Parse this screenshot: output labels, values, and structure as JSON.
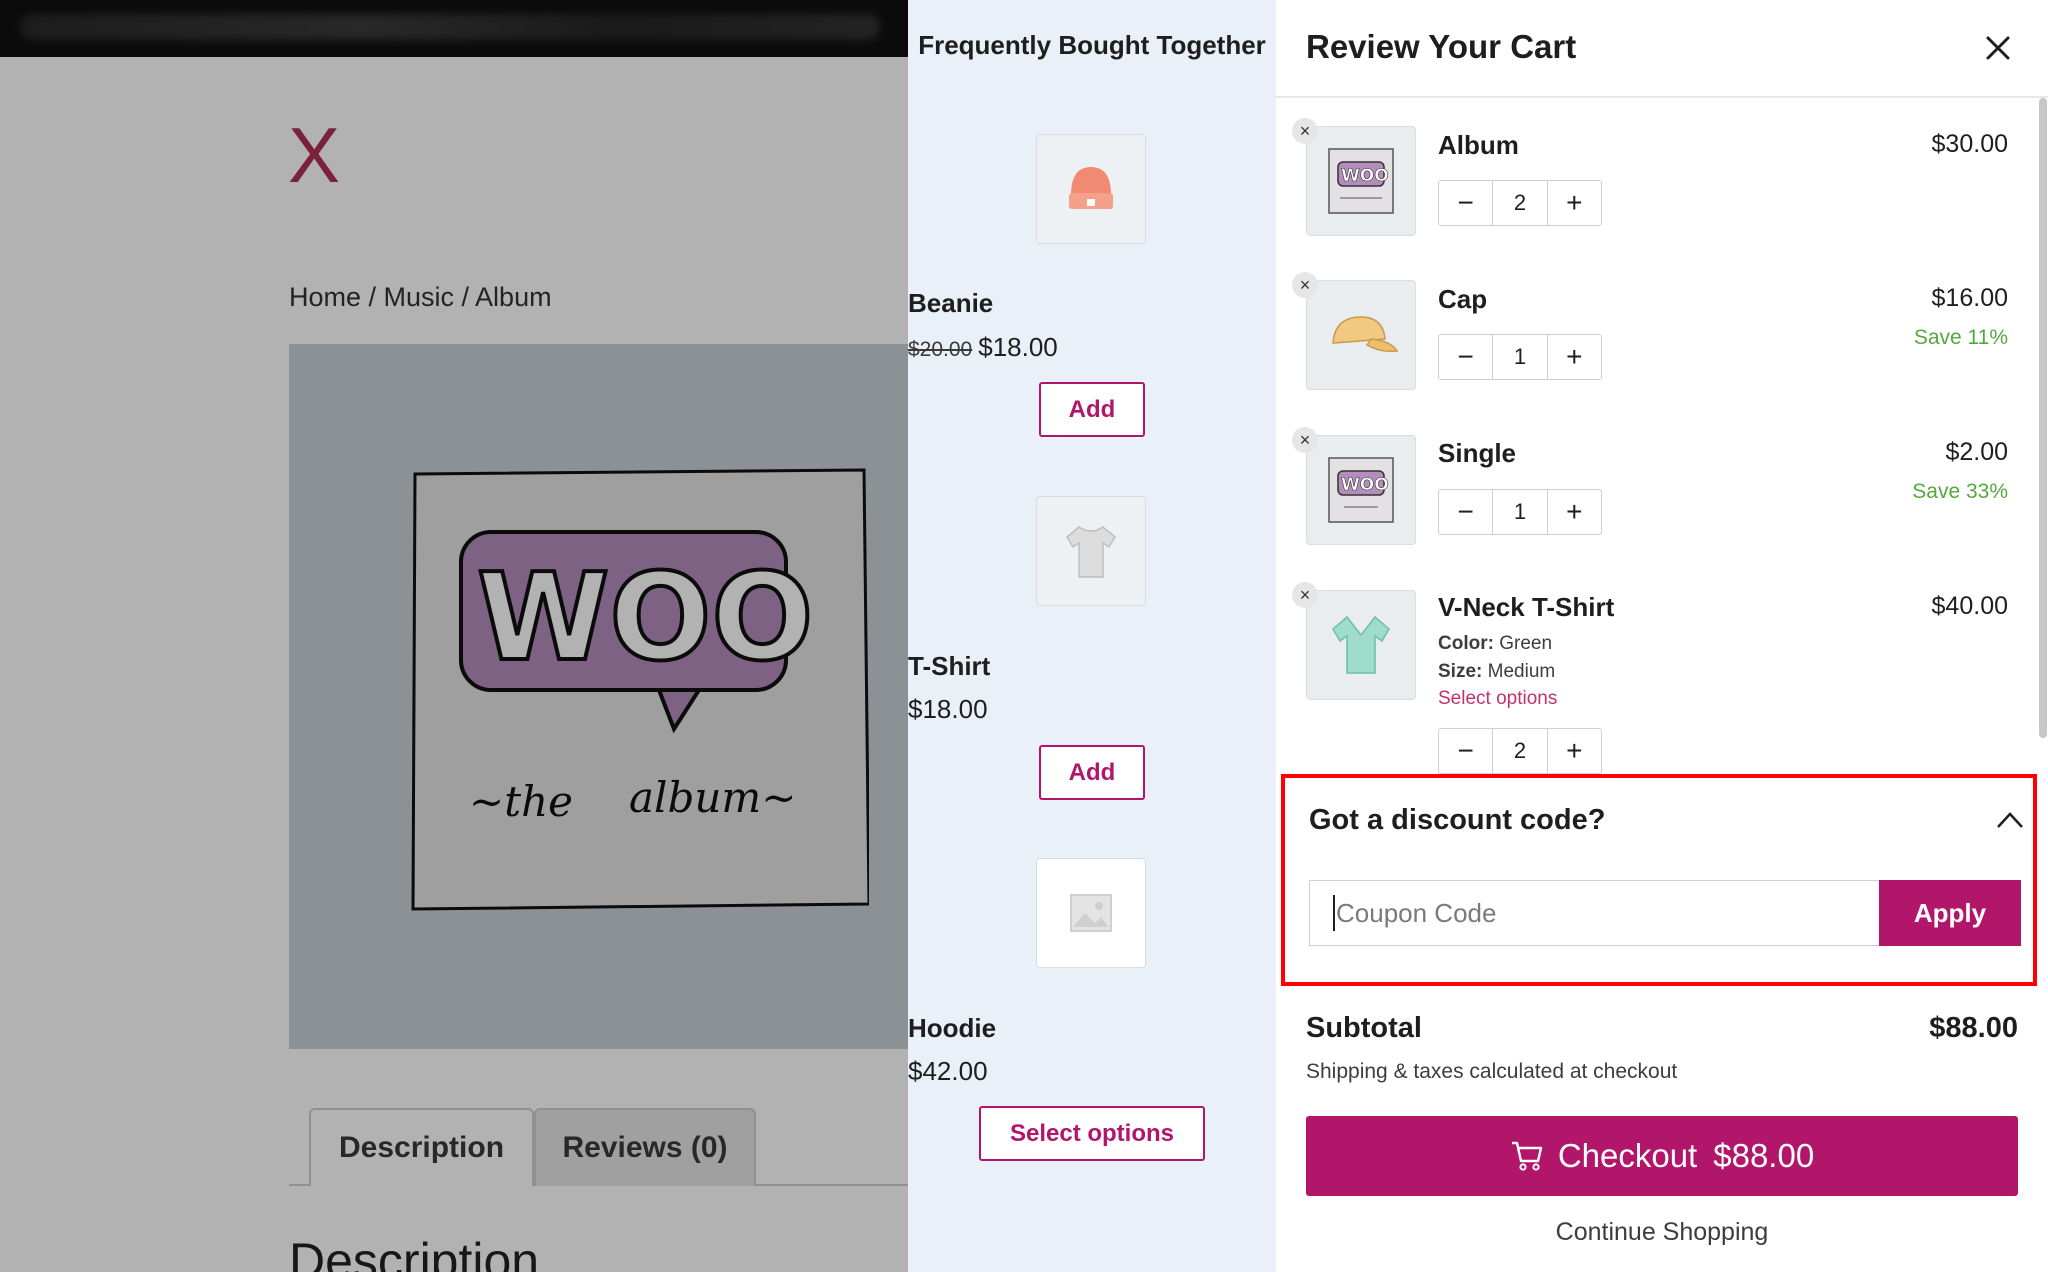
{
  "site": {
    "logo_text": "X",
    "breadcrumb": "Home / Music / Album",
    "tabs": [
      "Description",
      "Reviews (0)"
    ],
    "section_heading": "Description"
  },
  "fbt": {
    "title": "Frequently Bought Together",
    "items": [
      {
        "name": "Beanie",
        "old_price": "$20.00",
        "price": "$18.00",
        "button": "Add",
        "icon": "beanie-icon"
      },
      {
        "name": "T-Shirt",
        "price": "$18.00",
        "button": "Add",
        "icon": "tshirt-icon"
      },
      {
        "name": "Hoodie",
        "price": "$42.00",
        "button": "Select options",
        "icon": "image-placeholder-icon"
      }
    ]
  },
  "cart": {
    "title": "Review Your Cart",
    "items": [
      {
        "name": "Album",
        "price": "$30.00",
        "qty": "2",
        "icon": "woo-album-icon"
      },
      {
        "name": "Cap",
        "price": "$16.00",
        "save": "Save 11%",
        "qty": "1",
        "icon": "cap-icon"
      },
      {
        "name": "Single",
        "price": "$2.00",
        "save": "Save 33%",
        "qty": "1",
        "icon": "woo-single-icon"
      },
      {
        "name": "V-Neck T-Shirt",
        "price": "$40.00",
        "qty": "2",
        "icon": "vneck-icon",
        "color_label": "Color:",
        "color_value": "Green",
        "size_label": "Size:",
        "size_value": "Medium",
        "select_options": "Select options"
      }
    ],
    "discount": {
      "title": "Got a discount code?",
      "placeholder": "Coupon Code",
      "apply": "Apply"
    },
    "subtotal_label": "Subtotal",
    "subtotal_value": "$88.00",
    "shipping_note": "Shipping & taxes calculated at checkout",
    "checkout_label": "Checkout",
    "checkout_amount": "$88.00",
    "continue": "Continue Shopping"
  },
  "colors": {
    "accent": "#b1166b",
    "save_green": "#56a83c",
    "highlight_border": "#ff0000",
    "fbt_background": "#eaf0f7"
  }
}
